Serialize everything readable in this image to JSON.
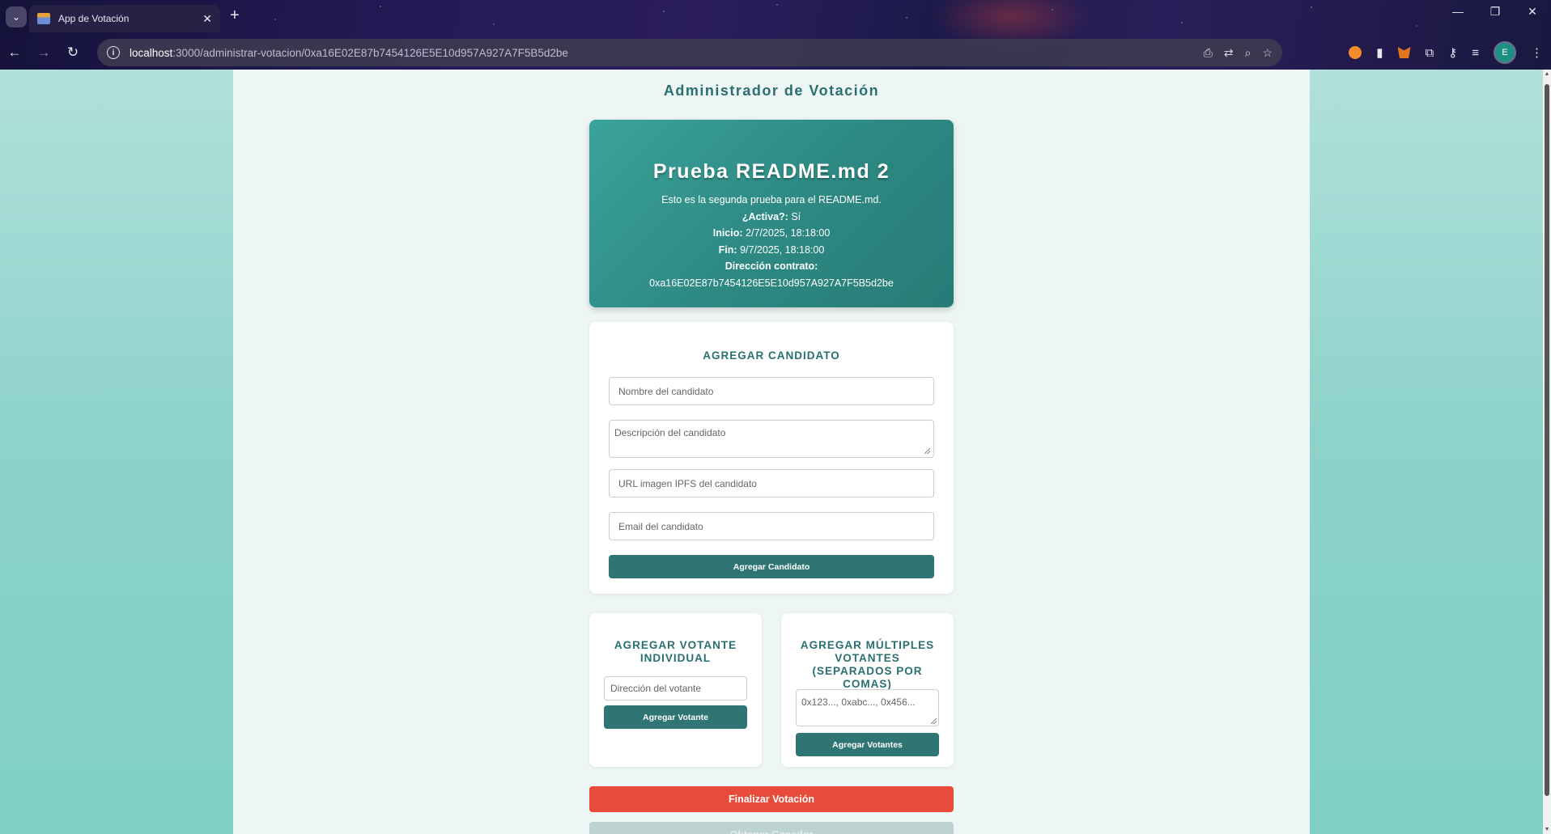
{
  "browser": {
    "tab_title": "App de Votación",
    "url_host": "localhost",
    "url_rest": ":3000/administrar-votacion/0xa16E02E87b7454126E5E10d957A927A7F5B5d2be",
    "avatar_letter": "E"
  },
  "page": {
    "title": "Administrador de Votación"
  },
  "voting": {
    "name": "Prueba README.md 2",
    "description": "Esto es la segunda prueba para el README.md.",
    "active_label": "¿Activa?:",
    "active_value": "Sí",
    "start_label": "Inicio:",
    "start_value": "2/7/2025, 18:18:00",
    "end_label": "Fin:",
    "end_value": "9/7/2025, 18:18:00",
    "contract_label": "Dirección contrato:",
    "contract_value": "0xa16E02E87b7454126E5E10d957A927A7F5B5d2be"
  },
  "add_candidate": {
    "heading": "AGREGAR CANDIDATO",
    "name_placeholder": "Nombre del candidato",
    "description_placeholder": "Descripción del candidato",
    "image_placeholder": "URL imagen IPFS del candidato",
    "email_placeholder": "Email del candidato",
    "button": "Agregar Candidato"
  },
  "add_voter": {
    "heading": "AGREGAR VOTANTE INDIVIDUAL",
    "address_placeholder": "Dirección del votante",
    "button": "Agregar Votante"
  },
  "add_voters": {
    "heading": "AGREGAR MÚLTIPLES VOTANTES (SEPARADOS POR COMAS)",
    "addresses_placeholder": "0x123..., 0xabc..., 0x456...",
    "button": "Agregar Votantes"
  },
  "actions": {
    "finalize": "Finalizar Votación",
    "winners": "Obtener Ganador"
  },
  "colors": {
    "accent": "#2e7574",
    "hero_start": "#3aa39c",
    "hero_end": "#287b76",
    "danger": "#e84b3a",
    "disabled": "#bcd3d1"
  }
}
